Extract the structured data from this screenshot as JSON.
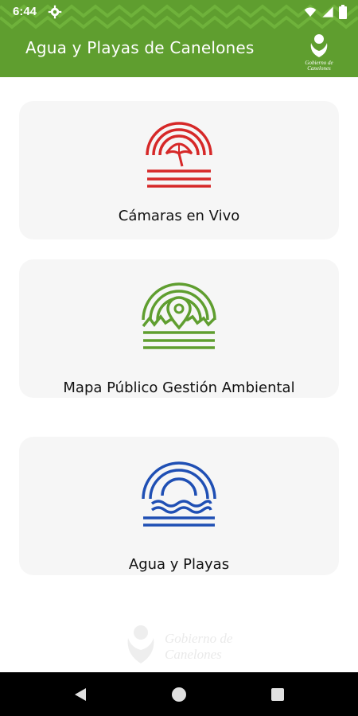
{
  "status": {
    "time": "6:44"
  },
  "header": {
    "title": "Agua y Playas de Canelones",
    "logo_text_line1": "Gobierno de",
    "logo_text_line2": "Canelones"
  },
  "cards": [
    {
      "label": "Cámaras en Vivo",
      "icon": "beach-umbrella-icon",
      "color": "#d62828"
    },
    {
      "label": "Mapa Público Gestión Ambiental",
      "icon": "map-pin-landscape-icon",
      "color": "#5f9e2f"
    },
    {
      "label": "Agua y Playas",
      "icon": "sun-waves-icon",
      "color": "#1f4fb4"
    }
  ],
  "footer": {
    "logo_line1": "Gobierno de",
    "logo_line2": "Canelones"
  },
  "colors": {
    "brand_green": "#5f9e2f",
    "card_bg": "#f6f6f6"
  }
}
